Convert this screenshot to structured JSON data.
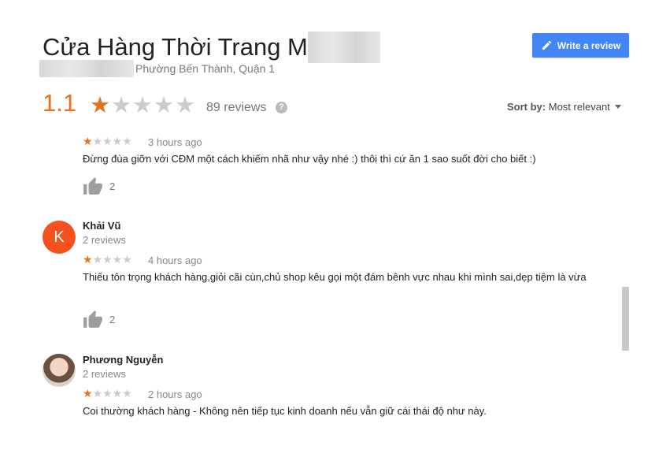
{
  "place": {
    "title": "Cửa Hàng Thời Trang M",
    "address": "Phường Bến Thành, Quận 1",
    "rating": "1.1",
    "stars_filled": 1,
    "stars_total": 5,
    "review_count": "89 reviews",
    "help_icon": "?"
  },
  "header": {
    "write_review_label": "Write a review",
    "sort_label": "Sort by:",
    "sort_value": "Most relevant"
  },
  "reviews": [
    {
      "name": "",
      "reviews_count": "",
      "stars_filled": 1,
      "time": "3 hours ago",
      "text": "Đừng đùa giỡn với CĐM một cách khiếm nhã như vậy nhé :) thôi thì cứ ăn 1 sao suốt đời cho biết :)",
      "likes": "2"
    },
    {
      "name": "Khải Vũ",
      "avatar_letter": "K",
      "reviews_count": "2 reviews",
      "stars_filled": 1,
      "time": "4 hours ago",
      "text": "Thiếu tôn trọng khách hàng,giỏi cãi cùn,chủ shop kêu gọi một đám bênh vực nhau khi mình sai,dẹp tiệm là vừa",
      "likes": "2"
    },
    {
      "name": "Phương Nguyễn",
      "reviews_count": "2 reviews",
      "stars_filled": 1,
      "time": "2 hours ago",
      "text": "Coi thường khách hàng - Không nên tiếp tục kinh doanh nếu vẫn giữ cái thái độ như này."
    }
  ],
  "colors": {
    "accent_orange": "#e7711b",
    "button_blue": "#4285f4",
    "star_empty": "#cccccc",
    "avatar_k": "#f4511e"
  },
  "icons": [
    "pencil-icon",
    "help-icon",
    "thumbs-up-icon",
    "chevron-down-icon",
    "star-icon"
  ]
}
